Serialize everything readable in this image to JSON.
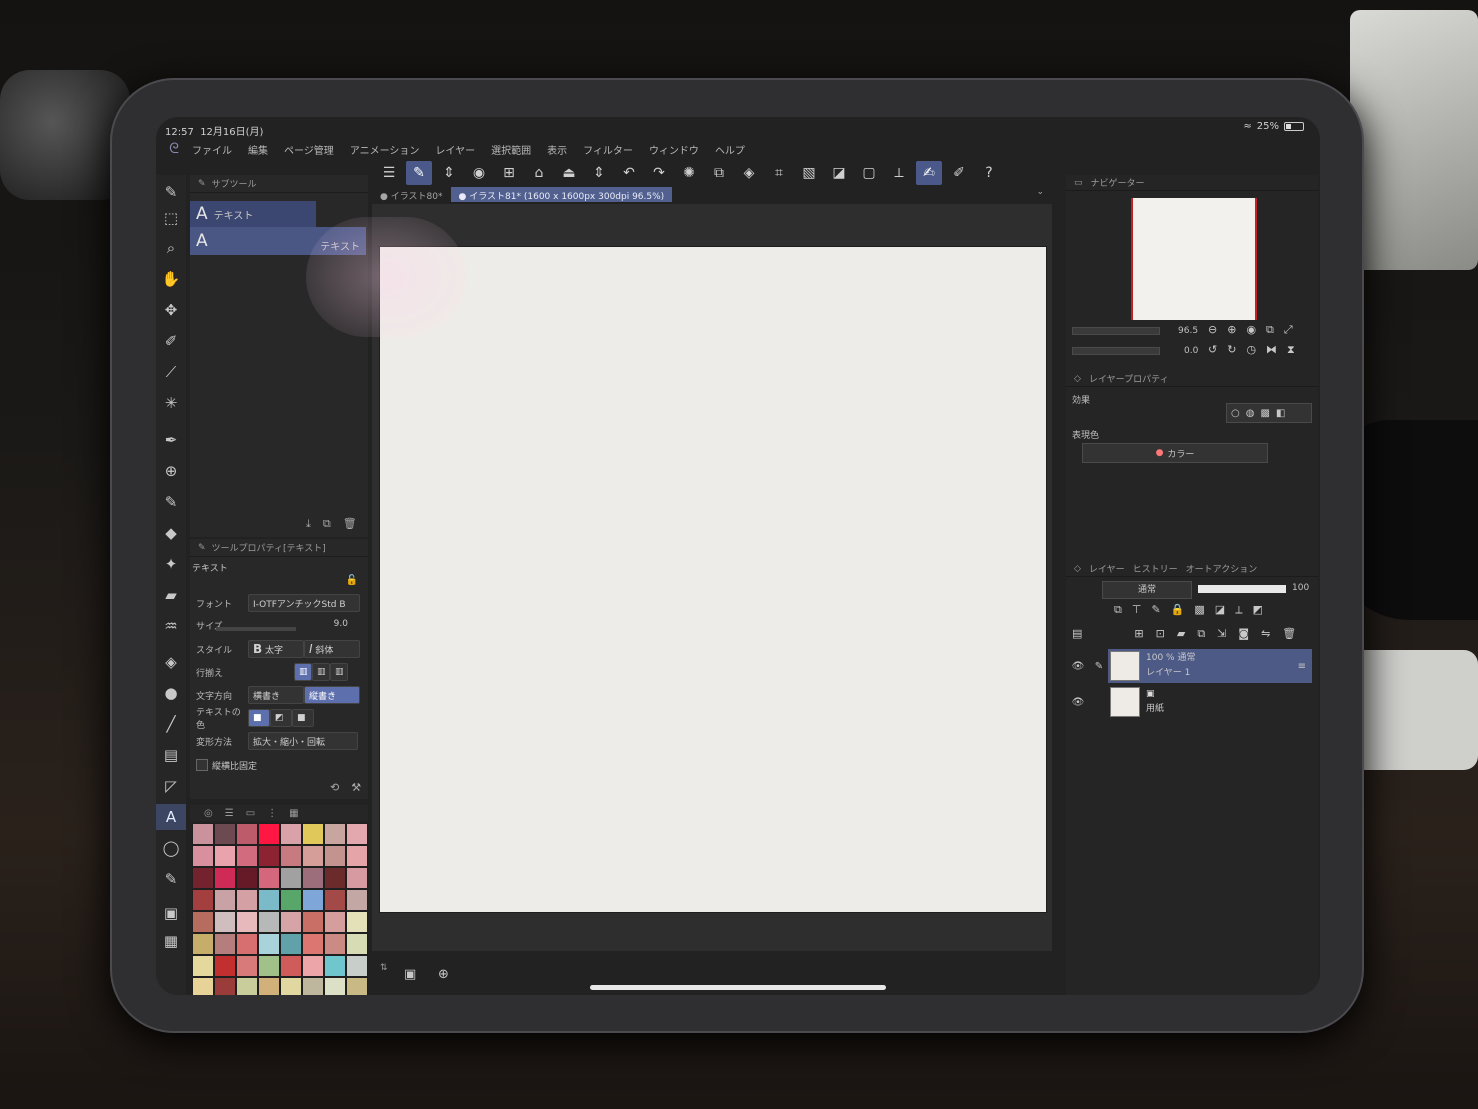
{
  "status": {
    "time": "12:57",
    "date": "12月16日(月)",
    "wifi_icon": "wifi-icon",
    "battery": "25%"
  },
  "menu": {
    "logo_icon": "clip-studio-logo-icon",
    "items": [
      "ファイル",
      "編集",
      "ページ管理",
      "アニメーション",
      "レイヤー",
      "選択範囲",
      "表示",
      "フィルター",
      "ウィンドウ",
      "ヘルプ"
    ]
  },
  "tool_rail": {
    "icons": [
      "pen-tip-icon",
      "select-icon",
      "zoom-icon",
      "hand-icon",
      "move-icon",
      "pen-icon",
      "eyedropper-icon",
      "magic-wand-icon",
      "pen-nib-icon",
      "airbrush-icon",
      "brush-icon",
      "blend-icon",
      "sparkle-icon",
      "eraser-icon",
      "liquify-icon",
      "fill-icon",
      "circle-icon",
      "line-icon",
      "grid-icon",
      "frame-icon",
      "text-icon",
      "lasso-icon",
      "correct-line-icon"
    ],
    "active": "text-icon"
  },
  "subtool": {
    "header": "サブツール",
    "items": [
      {
        "glyph": "A",
        "label": "テキスト"
      },
      {
        "glyph": "A",
        "label": "テキスト"
      }
    ]
  },
  "tool_property": {
    "header": "ツールプロパティ[テキスト]",
    "title": "テキスト",
    "font_label": "フォント",
    "font_value": "I-OTFアンチックStd B",
    "size_label": "サイズ",
    "size_value": "9.0",
    "style_label": "スタイル",
    "bold_label": "太字",
    "italic_label": "斜体",
    "align_label": "行揃え",
    "direction_label": "文字方向",
    "horizontal_label": "横書き",
    "vertical_label": "縦書き",
    "color_label": "テキストの色",
    "transform_label": "変形方法",
    "transform_value": "拡大・縮小・回転",
    "aspect_label": "縦横比固定"
  },
  "palette": {
    "colors": [
      "#c9929d",
      "#6d4a51",
      "#be5b6b",
      "#ff1744",
      "#d9a1a8",
      "#e0c95a",
      "#c8a59e",
      "#e2a8ad",
      "#d9909e",
      "#e8a3ad",
      "#d26b7d",
      "#8c2232",
      "#c77b80",
      "#d69e98",
      "#c39390",
      "#e5a5a8",
      "#74222d",
      "#d02a57",
      "#661a27",
      "#d4677c",
      "#a1a1a1",
      "#9c6e7c",
      "#6b2b2b",
      "#d89aa1",
      "#a43f3f",
      "#c9a2a5",
      "#d4a0a3",
      "#7bbac8",
      "#58a66a",
      "#7fa6d8",
      "#a34a48",
      "#c3a7a5",
      "#b76c60",
      "#d0bdbd",
      "#e7b8bc",
      "#b6b9b8",
      "#d6a3a7",
      "#c96f66",
      "#d59d9c",
      "#e4e0b8",
      "#c7ad6a",
      "#b57e7c",
      "#d76e6f",
      "#a8d3da",
      "#61a2aa",
      "#db7670",
      "#cc8a85",
      "#d8dcb4",
      "#e4d89c",
      "#c12f2f",
      "#d97a7a",
      "#a1c18b",
      "#d05b5b",
      "#eca6a9",
      "#6fc6cc",
      "#c8cfca",
      "#e7d297",
      "#9a3c3a",
      "#c9cc9b",
      "#d1b179",
      "#e1d7a1",
      "#bfb79d",
      "#dce0c6",
      "#c9b985"
    ]
  },
  "toolbar": {
    "icons": [
      "menu-icon",
      "edit-icon",
      "stepper-icon",
      "spiral-icon",
      "new-file-icon",
      "open-folder-icon",
      "save-icon",
      "stepper-icon",
      "undo-icon",
      "redo-icon",
      "loading-icon",
      "copy-icon",
      "fill-icon",
      "crop-icon",
      "clear-icon",
      "gradient-icon",
      "frame-icon",
      "ruler-icon",
      "brush-icon",
      "pen-icon",
      "help-icon"
    ]
  },
  "tabs": [
    {
      "label": "イラスト80*"
    },
    {
      "label": "イラスト81* (1600 x 1600px 300dpi 96.5%)"
    }
  ],
  "navigator": {
    "header": "ナビゲーター",
    "zoom": "96.5",
    "rotation": "0.0"
  },
  "layer_property": {
    "header": "レイヤープロパティ",
    "effect_label": "効果",
    "expression_label": "表現色",
    "expression_value": "カラー"
  },
  "layers": {
    "tabs": [
      "レイヤー",
      "ヒストリー",
      "オートアクション"
    ],
    "blend_mode": "通常",
    "opacity": "100",
    "items": [
      {
        "info": "100 %  通常",
        "name": "レイヤー 1"
      },
      {
        "info": "",
        "name": "用紙"
      }
    ]
  }
}
